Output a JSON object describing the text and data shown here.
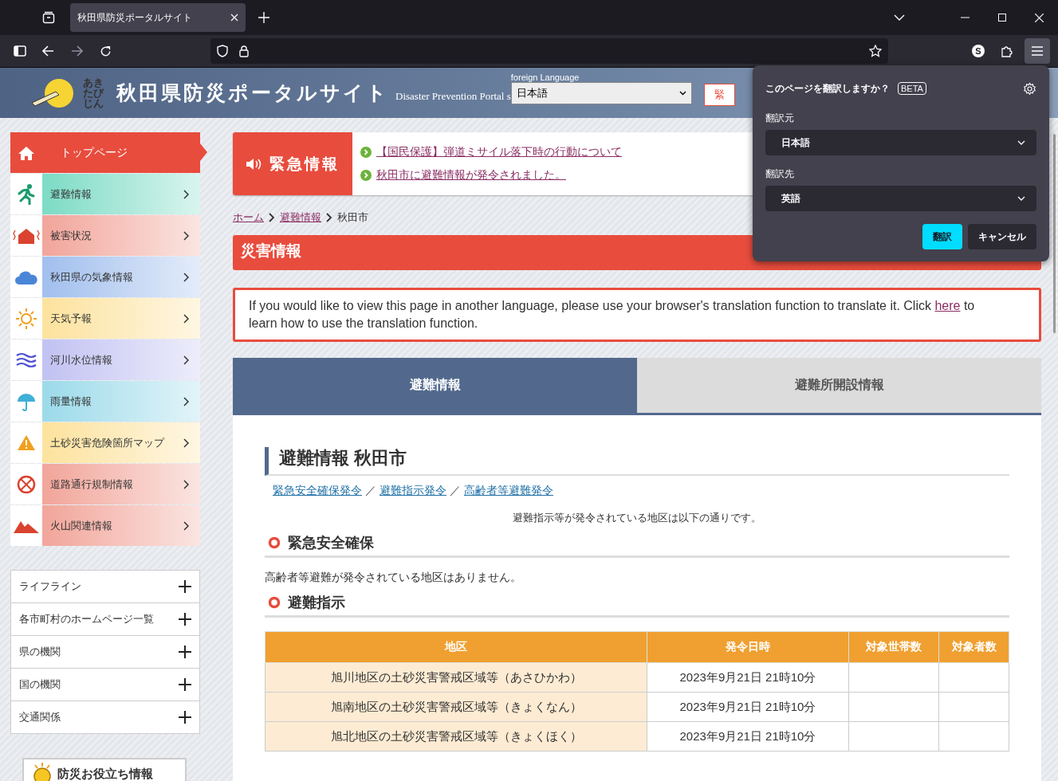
{
  "browser": {
    "tab": {
      "title": "秋田県防災ポータルサイト",
      "selected": true
    },
    "account_initial": "S"
  },
  "header": {
    "logo_text": "あきたびじん",
    "title": "秋田県防災ポータルサイト",
    "subtitle": "Disaster Prevention Portal s",
    "language_label": "foreign Language",
    "language_value": "日本語",
    "emergency_button": "緊"
  },
  "sidebar": {
    "items": [
      {
        "label": "トップページ",
        "selected": true,
        "color": "#e84c3d"
      },
      {
        "label": "避難情報",
        "selected": false,
        "color": "#7fdcc6"
      },
      {
        "label": "被害状況",
        "selected": false,
        "color": "#f2a79c"
      },
      {
        "label": "秋田県の気象情報",
        "selected": false,
        "color": "#a3c0ee"
      },
      {
        "label": "天気予報",
        "selected": false,
        "color": "#fde3a0"
      },
      {
        "label": "河川水位情報",
        "selected": false,
        "color": "#c3c3f3"
      },
      {
        "label": "雨量情報",
        "selected": false,
        "color": "#9edbea"
      },
      {
        "label": "土砂災害危険箇所マップ",
        "selected": false,
        "color": "#fde3a0"
      },
      {
        "label": "道路通行規制情報",
        "selected": false,
        "color": "#f2a79c"
      },
      {
        "label": "火山関連情報",
        "selected": false,
        "color": "#f2a79c"
      }
    ],
    "accordions": [
      {
        "label": "ライフライン",
        "expanded": false
      },
      {
        "label": "各市町村のホームページ一覧",
        "expanded": false
      },
      {
        "label": "県の機関",
        "expanded": false
      },
      {
        "label": "国の機関",
        "expanded": false
      },
      {
        "label": "交通関係",
        "expanded": false
      }
    ],
    "banner": "防災お役立ち情報"
  },
  "emergency": {
    "title": "緊急情報",
    "links": [
      "【国民保護】弾道ミサイル落下時の行動について",
      "秋田市に避難情報が発令されました。"
    ]
  },
  "breadcrumb": [
    {
      "label": "ホーム",
      "kind": "link"
    },
    {
      "label": "避難情報",
      "kind": "link"
    },
    {
      "label": "秋田市",
      "kind": "current"
    }
  ],
  "section_title": "災害情報",
  "notice": {
    "before": "If you would like to view this page in another language, please use your browser's translation function to translate it. Click ",
    "link": "here",
    "after": " to learn how to use the translation function."
  },
  "tabs": [
    {
      "label": "避難情報",
      "selected": true
    },
    {
      "label": "避難所開設情報",
      "selected": false
    }
  ],
  "content": {
    "heading": "避難情報 秋田市",
    "links": [
      "緊急安全確保発令",
      "避難指示発令",
      "高齢者等避難発令"
    ],
    "separator": "／",
    "note": "避難指示等が発令されている地区は以下の通りです。",
    "sections": [
      {
        "title": "緊急安全確保",
        "kind": "text",
        "text": "高齢者等避難が発令されている地区はありません。"
      },
      {
        "title": "避難指示",
        "kind": "table",
        "table": {
          "columns": [
            "地区",
            "発令日時",
            "対象世帯数",
            "対象者数"
          ],
          "rows": [
            [
              "旭川地区の土砂災害警戒区域等（あさひかわ）",
              "2023年9月21日 21時10分",
              "",
              ""
            ],
            [
              "旭南地区の土砂災害警戒区域等（きょくなん）",
              "2023年9月21日 21時10分",
              "",
              ""
            ],
            [
              "旭北地区の土砂災害警戒区域等（きょくほく）",
              "2023年9月21日 21時10分",
              "",
              ""
            ]
          ]
        }
      }
    ]
  },
  "translate_popup": {
    "title": "このページを翻訳しますか？",
    "badge": "BETA",
    "from_label": "翻訳元",
    "from_value": "日本語",
    "to_label": "翻訳先",
    "to_value": "英語",
    "buttons": [
      {
        "label": "翻訳",
        "kind": "primary"
      },
      {
        "label": "キャンセル",
        "kind": "secondary"
      }
    ]
  }
}
